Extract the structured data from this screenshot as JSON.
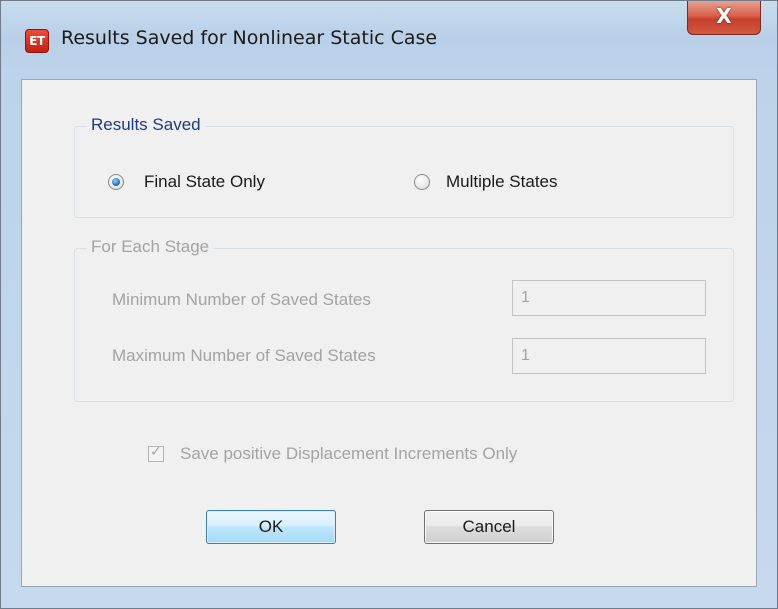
{
  "window": {
    "title": "Results Saved for Nonlinear Static Case",
    "app_icon_text": "ET",
    "close_label": "X"
  },
  "results_saved": {
    "legend": "Results Saved",
    "options": [
      {
        "label": "Final State Only",
        "selected": true
      },
      {
        "label": "Multiple States",
        "selected": false
      }
    ]
  },
  "for_each_stage": {
    "legend": "For Each Stage",
    "enabled": false,
    "min_label": "Minimum Number of Saved States",
    "min_value": "1",
    "max_label": "Maximum Number of Saved States",
    "max_value": "1"
  },
  "positive_increments": {
    "label": "Save positive Displacement Increments Only",
    "checked": true,
    "enabled": false,
    "tick": "✓"
  },
  "buttons": {
    "ok": "OK",
    "cancel": "Cancel"
  },
  "colors": {
    "accent_text": "#1d3a8a",
    "disabled_text": "#a3a3a3",
    "app_icon": "#d42a1c",
    "close_button": "#c7412c"
  }
}
